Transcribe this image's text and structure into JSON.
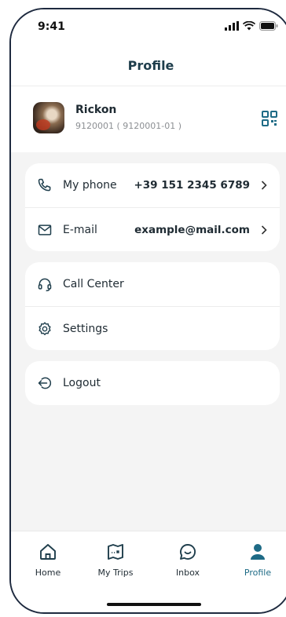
{
  "status": {
    "time": "9:41"
  },
  "header": {
    "title": "Profile"
  },
  "profile": {
    "name": "Rickon",
    "id": "9120001 ( 9120001-01 )"
  },
  "contact": {
    "phone": {
      "label": "My phone",
      "value": "+39 151 2345 6789"
    },
    "email": {
      "label": "E-mail",
      "value": "example@mail.com"
    }
  },
  "menu": {
    "call_center": "Call Center",
    "settings": "Settings"
  },
  "logout": {
    "label": "Logout"
  },
  "tabs": {
    "home": "Home",
    "trips": "My Trips",
    "inbox": "Inbox",
    "profile": "Profile"
  },
  "colors": {
    "accent": "#1e6b86",
    "text": "#1f2b33",
    "background": "#f4f4f4"
  }
}
